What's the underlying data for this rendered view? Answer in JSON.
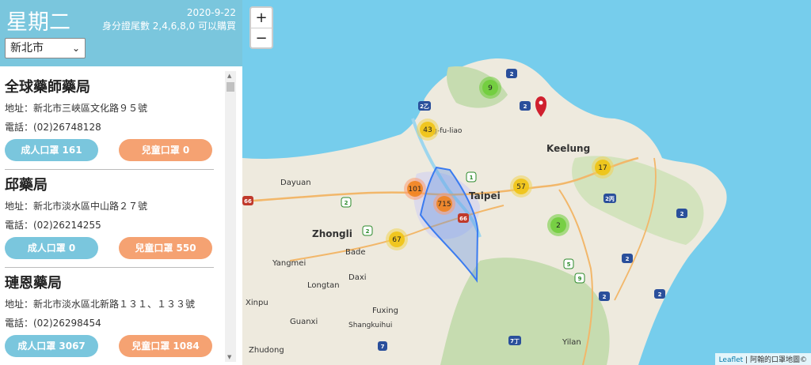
{
  "header": {
    "weekday": "星期二",
    "date": "2020-9-22",
    "rule": "身分證尾數 2,4,6,8,0 可以購買"
  },
  "city_select": {
    "value": "新北市"
  },
  "pharmacies": [
    {
      "name": "全球藥師藥局",
      "address": "地址：新北市三峽區文化路９５號",
      "phone": "電話：(02)26748128",
      "adult": "成人口罩 161",
      "child": "兒童口罩 0"
    },
    {
      "name": "邱藥局",
      "address": "地址：新北市淡水區中山路２７號",
      "phone": "電話：(02)26214255",
      "adult": "成人口罩 0",
      "child": "兒童口罩 550"
    },
    {
      "name": "璉恩藥局",
      "address": "地址：新北市淡水區北新路１３１、１３３號",
      "phone": "電話：(02)26298454",
      "adult": "成人口罩 3067",
      "child": "兒童口罩 1084"
    }
  ],
  "map": {
    "zoom_in": "+",
    "zoom_out": "−",
    "places": [
      "Keelung",
      "Taipei",
      "Zhongli",
      "Dayuan",
      "Bade",
      "Yangmei",
      "Daxi",
      "Longtan",
      "Xinpu",
      "Fuxing",
      "Guanxi",
      "Shangkuihui",
      "Zhudong",
      "Yilan",
      "...ng-fu-liao"
    ],
    "clusters": [
      "9",
      "43",
      "101",
      "715",
      "57",
      "17",
      "67",
      "2"
    ],
    "road_shields": [
      "2",
      "2",
      "2乙",
      "1",
      "2",
      "66",
      "66",
      "2",
      "2丙",
      "2",
      "2",
      "5",
      "9",
      "2",
      "2",
      "7",
      "7丁"
    ],
    "attribution_link": "Leaflet",
    "attribution_text": "| 阿翰的口罩地圖©"
  },
  "colors": {
    "header": "#7ac6dd",
    "adult": "#7ac6dd",
    "child": "#f5a272",
    "sea": "#76cdec",
    "marker": "#d0202e"
  }
}
